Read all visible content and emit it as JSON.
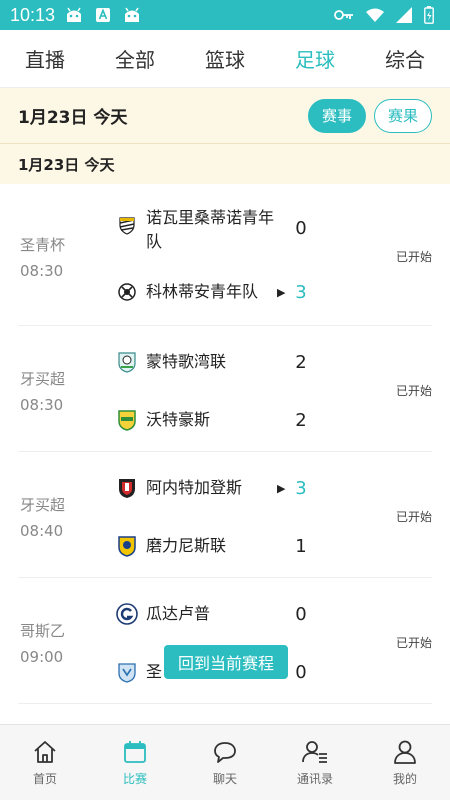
{
  "status_bar": {
    "time": "10:13",
    "icons": [
      "android-icon",
      "a-icon",
      "android-icon",
      "key-icon",
      "wifi-icon",
      "signal-icon",
      "battery-icon"
    ]
  },
  "top_tabs": [
    {
      "label": "直播",
      "active": false
    },
    {
      "label": "全部",
      "active": false
    },
    {
      "label": "篮球",
      "active": false
    },
    {
      "label": "足球",
      "active": true
    },
    {
      "label": "综合",
      "active": false
    }
  ],
  "date_header": {
    "date_title": "1月23日  今天",
    "schedule_btn": "赛事",
    "results_btn": "赛果",
    "section_date": "1月23日  今天"
  },
  "matches": [
    {
      "league": "圣青杯",
      "time": "08:30",
      "home": {
        "name": "诺瓦里桑蒂诺青年队",
        "score": "0"
      },
      "away": {
        "name": "科林蒂安青年队",
        "score": "3"
      },
      "status": "已开始"
    },
    {
      "league": "牙买超",
      "time": "08:30",
      "home": {
        "name": "蒙特歌湾联",
        "score": "2"
      },
      "away": {
        "name": "沃特豪斯",
        "score": "2"
      },
      "status": "已开始"
    },
    {
      "league": "牙买超",
      "time": "08:40",
      "home": {
        "name": "阿内特加登斯",
        "score": "3"
      },
      "away": {
        "name": "磨力尼斯联",
        "score": "1"
      },
      "status": "已开始"
    },
    {
      "league": "哥斯乙",
      "time": "09:00",
      "home": {
        "name": "瓜达卢普",
        "score": "0"
      },
      "away": {
        "name": "圣",
        "score": "0"
      },
      "status": "已开始"
    }
  ],
  "float_button": "回到当前赛程",
  "bottom_nav": [
    {
      "label": "首页",
      "icon": "home-icon",
      "active": false
    },
    {
      "label": "比赛",
      "icon": "calendar-icon",
      "active": true
    },
    {
      "label": "聊天",
      "icon": "chat-icon",
      "active": false
    },
    {
      "label": "通讯录",
      "icon": "contacts-icon",
      "active": false
    },
    {
      "label": "我的",
      "icon": "profile-icon",
      "active": false
    }
  ],
  "colors": {
    "accent": "#2bbdbf",
    "date_bg": "#fdf8e6",
    "nav_bg": "#f6f6f6"
  }
}
